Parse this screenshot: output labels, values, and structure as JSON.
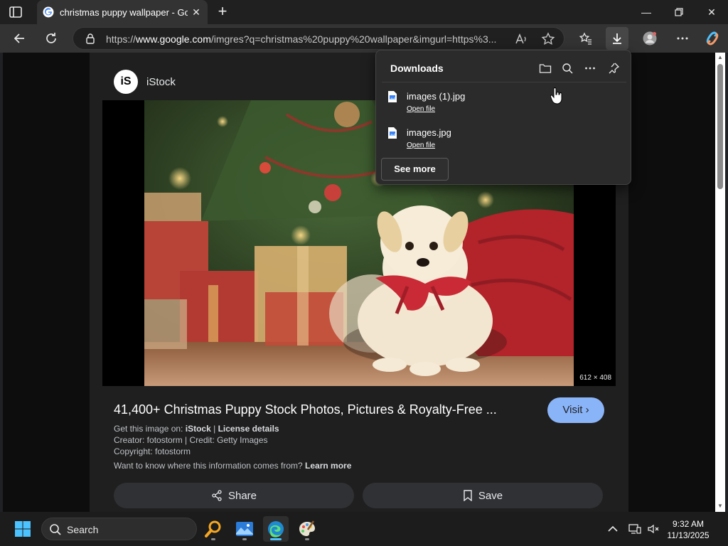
{
  "browser": {
    "tab_title": "christmas puppy wallpaper - Goo",
    "url_prefix": "https://",
    "url_domain": "www.google.com",
    "url_rest": "/imgres?q=christmas%20puppy%20wallpaper&imgurl=https%3..."
  },
  "downloads": {
    "title": "Downloads",
    "items": [
      {
        "file_name": "images (1).jpg",
        "action": "Open file"
      },
      {
        "file_name": "images.jpg",
        "action": "Open file"
      }
    ],
    "see_more": "See more"
  },
  "result": {
    "source_logo": "iS",
    "source_name": "iStock",
    "image_dimensions": "612 × 408",
    "title": "41,400+ Christmas Puppy Stock Photos, Pictures & Royalty-Free ...",
    "visit_label": "Visit",
    "get_image_prefix": "Get this image on:",
    "get_image_source": "iStock",
    "separator": "|",
    "license_details": "License details",
    "creator_line": "Creator: fotostorm | Credit: Getty Images",
    "copyright_line": "Copyright: fotostorm",
    "info_question": "Want to know where this information comes from?",
    "learn_more": "Learn more",
    "share_label": "Share",
    "save_label": "Save"
  },
  "taskbar": {
    "search_label": "Search",
    "time": "9:32 AM",
    "date": "11/13/2025"
  },
  "colors": {
    "visit_button": "#8ab4f8",
    "edge_accent": "#4cc2ff"
  }
}
